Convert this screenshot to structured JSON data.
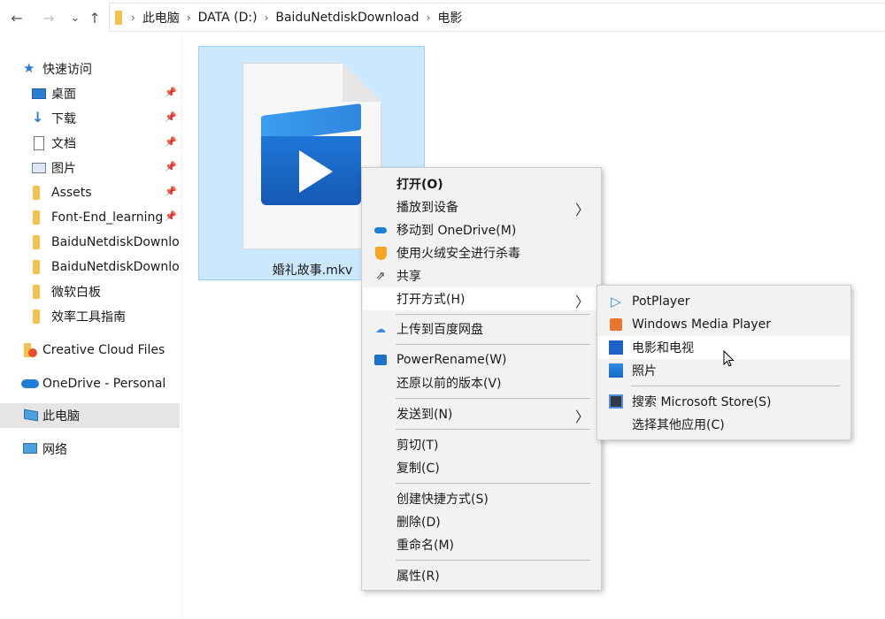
{
  "nav": {
    "back": "←",
    "forward": "→",
    "recent": "⌄",
    "up": "↑"
  },
  "breadcrumb": {
    "separator": "›",
    "items": [
      "此电脑",
      "DATA (D:)",
      "BaiduNetdiskDownload",
      "电影"
    ]
  },
  "sidebar": {
    "quick_access": "快速访问",
    "items": [
      {
        "label": "桌面",
        "icon": "desktop-icon"
      },
      {
        "label": "下载",
        "icon": "download-icon"
      },
      {
        "label": "文档",
        "icon": "document-icon"
      },
      {
        "label": "图片",
        "icon": "pictures-icon"
      },
      {
        "label": "Assets",
        "icon": "folder-icon"
      },
      {
        "label": "Font-End_learning",
        "icon": "folder-icon"
      },
      {
        "label": "BaiduNetdiskDownload",
        "icon": "folder-icon"
      },
      {
        "label": "BaiduNetdiskDownload",
        "icon": "folder-icon"
      },
      {
        "label": "微软白板",
        "icon": "folder-icon"
      },
      {
        "label": "效率工具指南",
        "icon": "folder-icon"
      }
    ],
    "creative_cloud": "Creative Cloud Files",
    "onedrive": "OneDrive - Personal",
    "this_pc": "此电脑",
    "network": "网络"
  },
  "file": {
    "name": "婚礼故事.mkv"
  },
  "context_menu": {
    "items": {
      "open": "打开(O)",
      "cast": "播放到设备",
      "onedrive_move": "移动到 OneDrive(M)",
      "scan": "使用火绒安全进行杀毒",
      "share": "共享",
      "open_with": "打开方式(H)",
      "upload_baidu": "上传到百度网盘",
      "power_rename": "PowerRename(W)",
      "restore": "还原以前的版本(V)",
      "send_to": "发送到(N)",
      "cut": "剪切(T)",
      "copy": "复制(C)",
      "shortcut": "创建快捷方式(S)",
      "delete": "删除(D)",
      "rename": "重命名(M)",
      "properties": "属性(R)"
    }
  },
  "submenu": {
    "items": {
      "potplayer": "PotPlayer",
      "wmp": "Windows Media Player",
      "movies_tv": "电影和电视",
      "photos": "照片",
      "store": "搜索 Microsoft Store(S)",
      "other": "选择其他应用(C)"
    }
  },
  "colors": {
    "selection": "#cce8ff",
    "selection_border": "#99d1ff",
    "menu_bg": "#f2f2f2",
    "folder": "#f2c14e",
    "accent": "#1a73e8"
  }
}
